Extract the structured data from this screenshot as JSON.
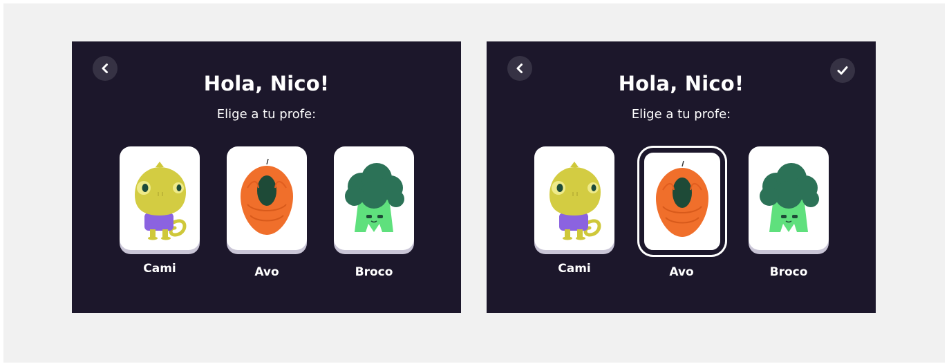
{
  "screens": [
    {
      "id": "unselected",
      "title": "Hola, Nico!",
      "subtitle": "Elige a tu profe:",
      "teachers": [
        {
          "name": "Cami",
          "selected": false
        },
        {
          "name": "Avo",
          "selected": false
        },
        {
          "name": "Broco",
          "selected": false
        }
      ],
      "buttons": {
        "back": "chevron-left-icon"
      }
    },
    {
      "id": "selected",
      "title": "Hola, Nico!",
      "subtitle": "Elige a tu profe:",
      "teachers": [
        {
          "name": "Cami",
          "selected": false
        },
        {
          "name": "Avo",
          "selected": true
        },
        {
          "name": "Broco",
          "selected": false
        }
      ],
      "buttons": {
        "back": "chevron-left-icon",
        "confirm": "checkmark-icon"
      }
    }
  ],
  "colors": {
    "screen_background": "#1c172b",
    "canvas_background": "#f1f1f1",
    "card_background": "#ffffff",
    "button_background": "#363244",
    "selected_outline": "#ffffff"
  }
}
